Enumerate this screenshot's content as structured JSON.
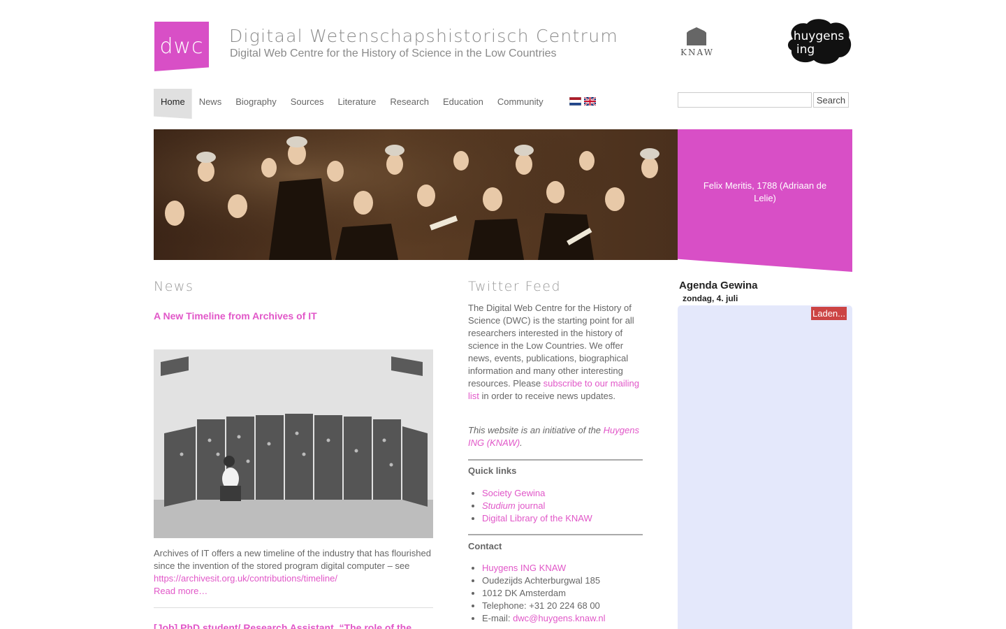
{
  "header": {
    "logo_text": "dwc",
    "title_nl": "Digitaal Wetenschapshistorisch Centrum",
    "title_en": "Digital Web Centre for the History of Science in the Low Countries",
    "knaw_text": "KNAW",
    "huygens_line1": "huygens",
    "huygens_line2": "ing"
  },
  "nav": {
    "items": [
      {
        "label": "Home",
        "active": true
      },
      {
        "label": "News"
      },
      {
        "label": "Biography"
      },
      {
        "label": "Sources"
      },
      {
        "label": "Literature"
      },
      {
        "label": "Research"
      },
      {
        "label": "Education"
      },
      {
        "label": "Community"
      }
    ],
    "search_button": "Search",
    "search_value": ""
  },
  "banner": {
    "caption": "Felix Meritis, 1788 (Adriaan de Lelie)"
  },
  "news": {
    "heading": "News",
    "item1": {
      "title": "A New Timeline from Archives of IT",
      "text": "Archives of IT offers a new timeline of the industry that has flourished since the invention of the stored program digital computer – see ",
      "link": "https://archivesit.org.uk/contributions/timeline/",
      "read_more": "Read more…"
    },
    "item2_title": "[Job] PhD student/ Research Assistant, “The role of the"
  },
  "twitter": {
    "heading": "Twitter Feed",
    "intro_before": "The Digital Web Centre for the History of Science (DWC) is the starting point for all researchers interested in the history of science in the Low Countries. We offer news, events, publications, biographical information and many other interesting resources. Please ",
    "intro_link": "subscribe to our mailing list",
    "intro_after": " in order to receive news updates.",
    "initiative_before": "This website is an initiative of the ",
    "initiative_link": "Huygens ING (KNAW)",
    "initiative_after": "."
  },
  "quick_links": {
    "heading": "Quick links",
    "items": {
      "gewina": "Society Gewina",
      "studium_italic": "Studium",
      "studium_rest": " journal",
      "dl": "Digital Library of the KNAW"
    }
  },
  "contact": {
    "heading": "Contact",
    "org": "Huygens ING KNAW",
    "address1": "Oudezijds Achterburgwal 185",
    "address2": "1012 DK Amsterdam",
    "phone": "Telephone: +31 20 224 68 00",
    "email_label": "E-mail: ",
    "email": "dwc@huygens.knaw.nl"
  },
  "agenda": {
    "title": "Agenda Gewina",
    "date": "zondag, 4. juli",
    "loading": "Laden..."
  },
  "colors": {
    "accent": "#d84fc6",
    "link": "#e157c8",
    "agenda_bg": "#e4e8fb",
    "loading_bg": "#cc4444"
  }
}
